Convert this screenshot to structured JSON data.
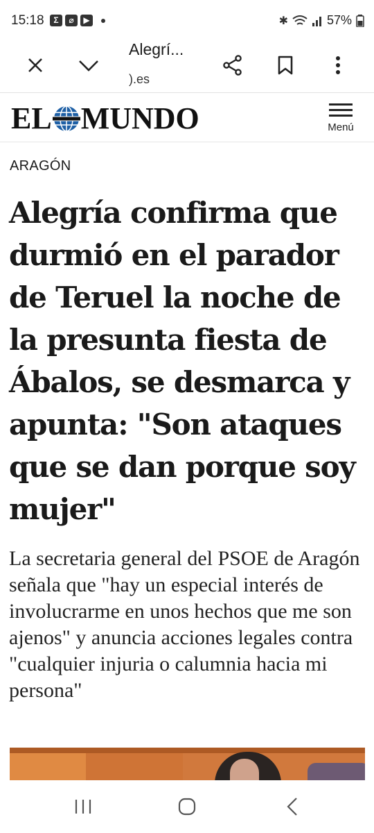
{
  "status_bar": {
    "time": "15:18",
    "left_icons": [
      "sigma-icon",
      "leaf-icon",
      "youtube-icon",
      "dot-icon"
    ],
    "battery": "57%",
    "right_icons": [
      "bluetooth-icon",
      "wifi-icon",
      "signal-icon",
      "battery-icon"
    ]
  },
  "browser": {
    "page_title": "Alegrí...",
    "domain": ").es"
  },
  "site": {
    "logo_left": "EL",
    "logo_right": "MUNDO",
    "menu_label": "Menú"
  },
  "article": {
    "section": "ARAGÓN",
    "headline": "Alegría confirma que durmió en el parador de Teruel la noche de la presunta fiesta de Ábalos, se desmarca y apunta: \"Son ataques que se dan porque soy mujer\"",
    "standfirst": "La secretaria general del PSOE de Aragón señala que \"hay un especial interés de involucrarme en unos hechos que me son ajenos\" y anuncia acciones legales contra \"cualquier injuria o calumnia hacia mi persona\""
  }
}
